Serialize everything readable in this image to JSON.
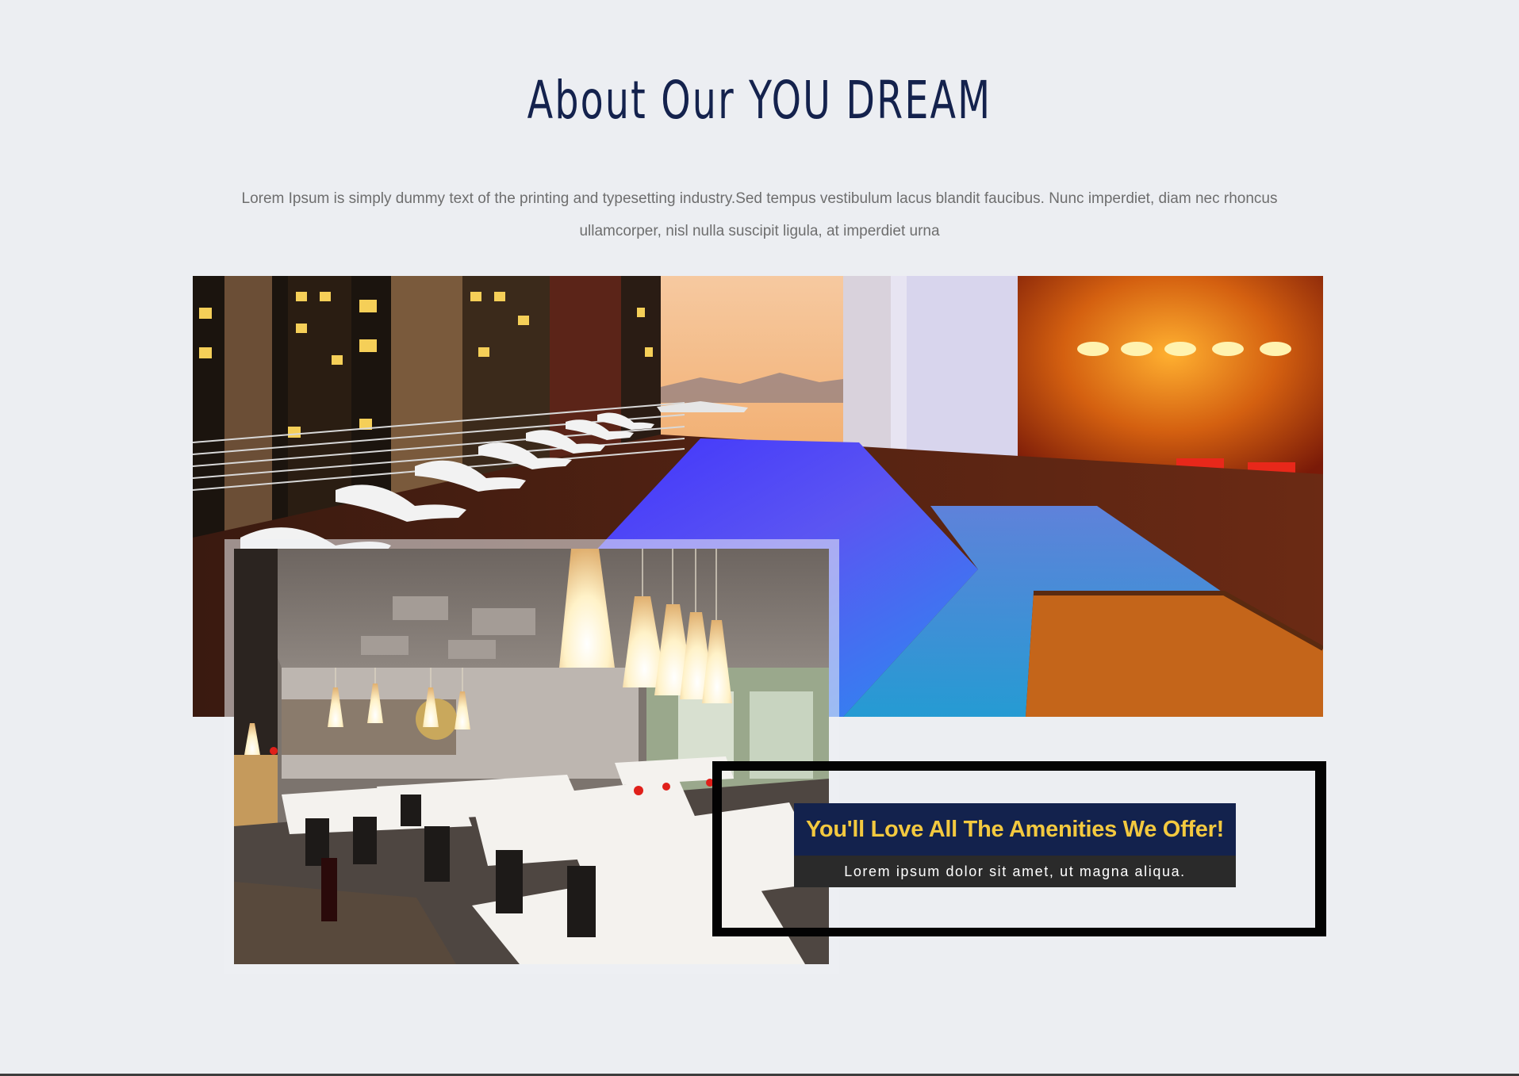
{
  "about": {
    "title": "About Our YOU DREAM",
    "description": "Lorem Ipsum is simply dummy text of the printing and typesetting industry.Sed tempus vestibulum lacus blandit faucibus. Nunc imperdiet, diam nec rhoncus ullamcorper, nisl nulla suscipit ligula, at imperdiet urna"
  },
  "offer": {
    "title": "You'll Love All The Amenities We Offer!",
    "subtitle": "Lorem ipsum dolor sit amet, ut magna aliqua."
  },
  "colors": {
    "background": "#eceef2",
    "title_navy": "#14224d",
    "offer_title_bg": "#13224d",
    "offer_title_text": "#f3c93f",
    "offer_sub_bg": "#2a2a2a"
  }
}
